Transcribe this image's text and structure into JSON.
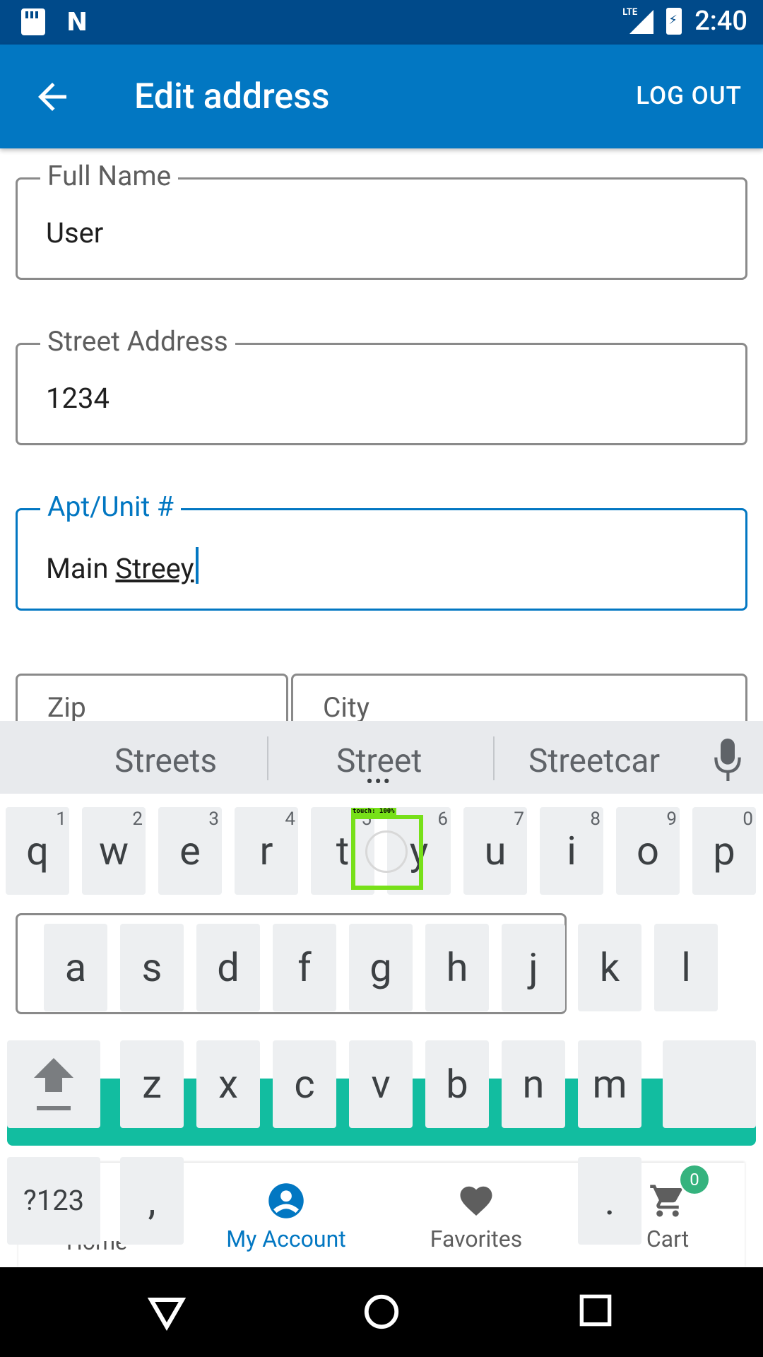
{
  "status_bar": {
    "time": "2:40",
    "network": "LTE"
  },
  "app_bar": {
    "title": "Edit address",
    "logout_label": "LOG OUT"
  },
  "form": {
    "full_name": {
      "label": "Full Name",
      "value": "User"
    },
    "street": {
      "label": "Street Address",
      "value": "1234"
    },
    "apt": {
      "label": "Apt/Unit #",
      "value_plain": "Main ",
      "value_underlined": "Streey"
    },
    "zip": {
      "label": "Zip"
    },
    "city": {
      "label": "City"
    }
  },
  "keyboard": {
    "suggestions": [
      "Streets",
      "Street",
      "Streetcar"
    ],
    "row1": [
      {
        "k": "q",
        "h": "1"
      },
      {
        "k": "w",
        "h": "2"
      },
      {
        "k": "e",
        "h": "3"
      },
      {
        "k": "r",
        "h": "4"
      },
      {
        "k": "t",
        "h": "5"
      },
      {
        "k": "y",
        "h": "6"
      },
      {
        "k": "u",
        "h": "7"
      },
      {
        "k": "i",
        "h": "8"
      },
      {
        "k": "o",
        "h": "9"
      },
      {
        "k": "p",
        "h": "0"
      }
    ],
    "row2": [
      "a",
      "s",
      "d",
      "f",
      "g",
      "h",
      "j",
      "k",
      "l"
    ],
    "row3": [
      "z",
      "x",
      "c",
      "v",
      "b",
      "n",
      "m"
    ],
    "symbols_label": "?123",
    "comma": ",",
    "period": ".",
    "touch_label": "touch: 100%"
  },
  "bottom_nav": {
    "items": [
      {
        "label": "Home"
      },
      {
        "label": "My Account",
        "active": true
      },
      {
        "label": "Favorites"
      },
      {
        "label": "Cart",
        "badge": "0"
      }
    ]
  },
  "colors": {
    "primary": "#0277c2",
    "status_bar": "#004a8a",
    "accent_green": "#12bda0",
    "touch_green": "#77e019"
  }
}
